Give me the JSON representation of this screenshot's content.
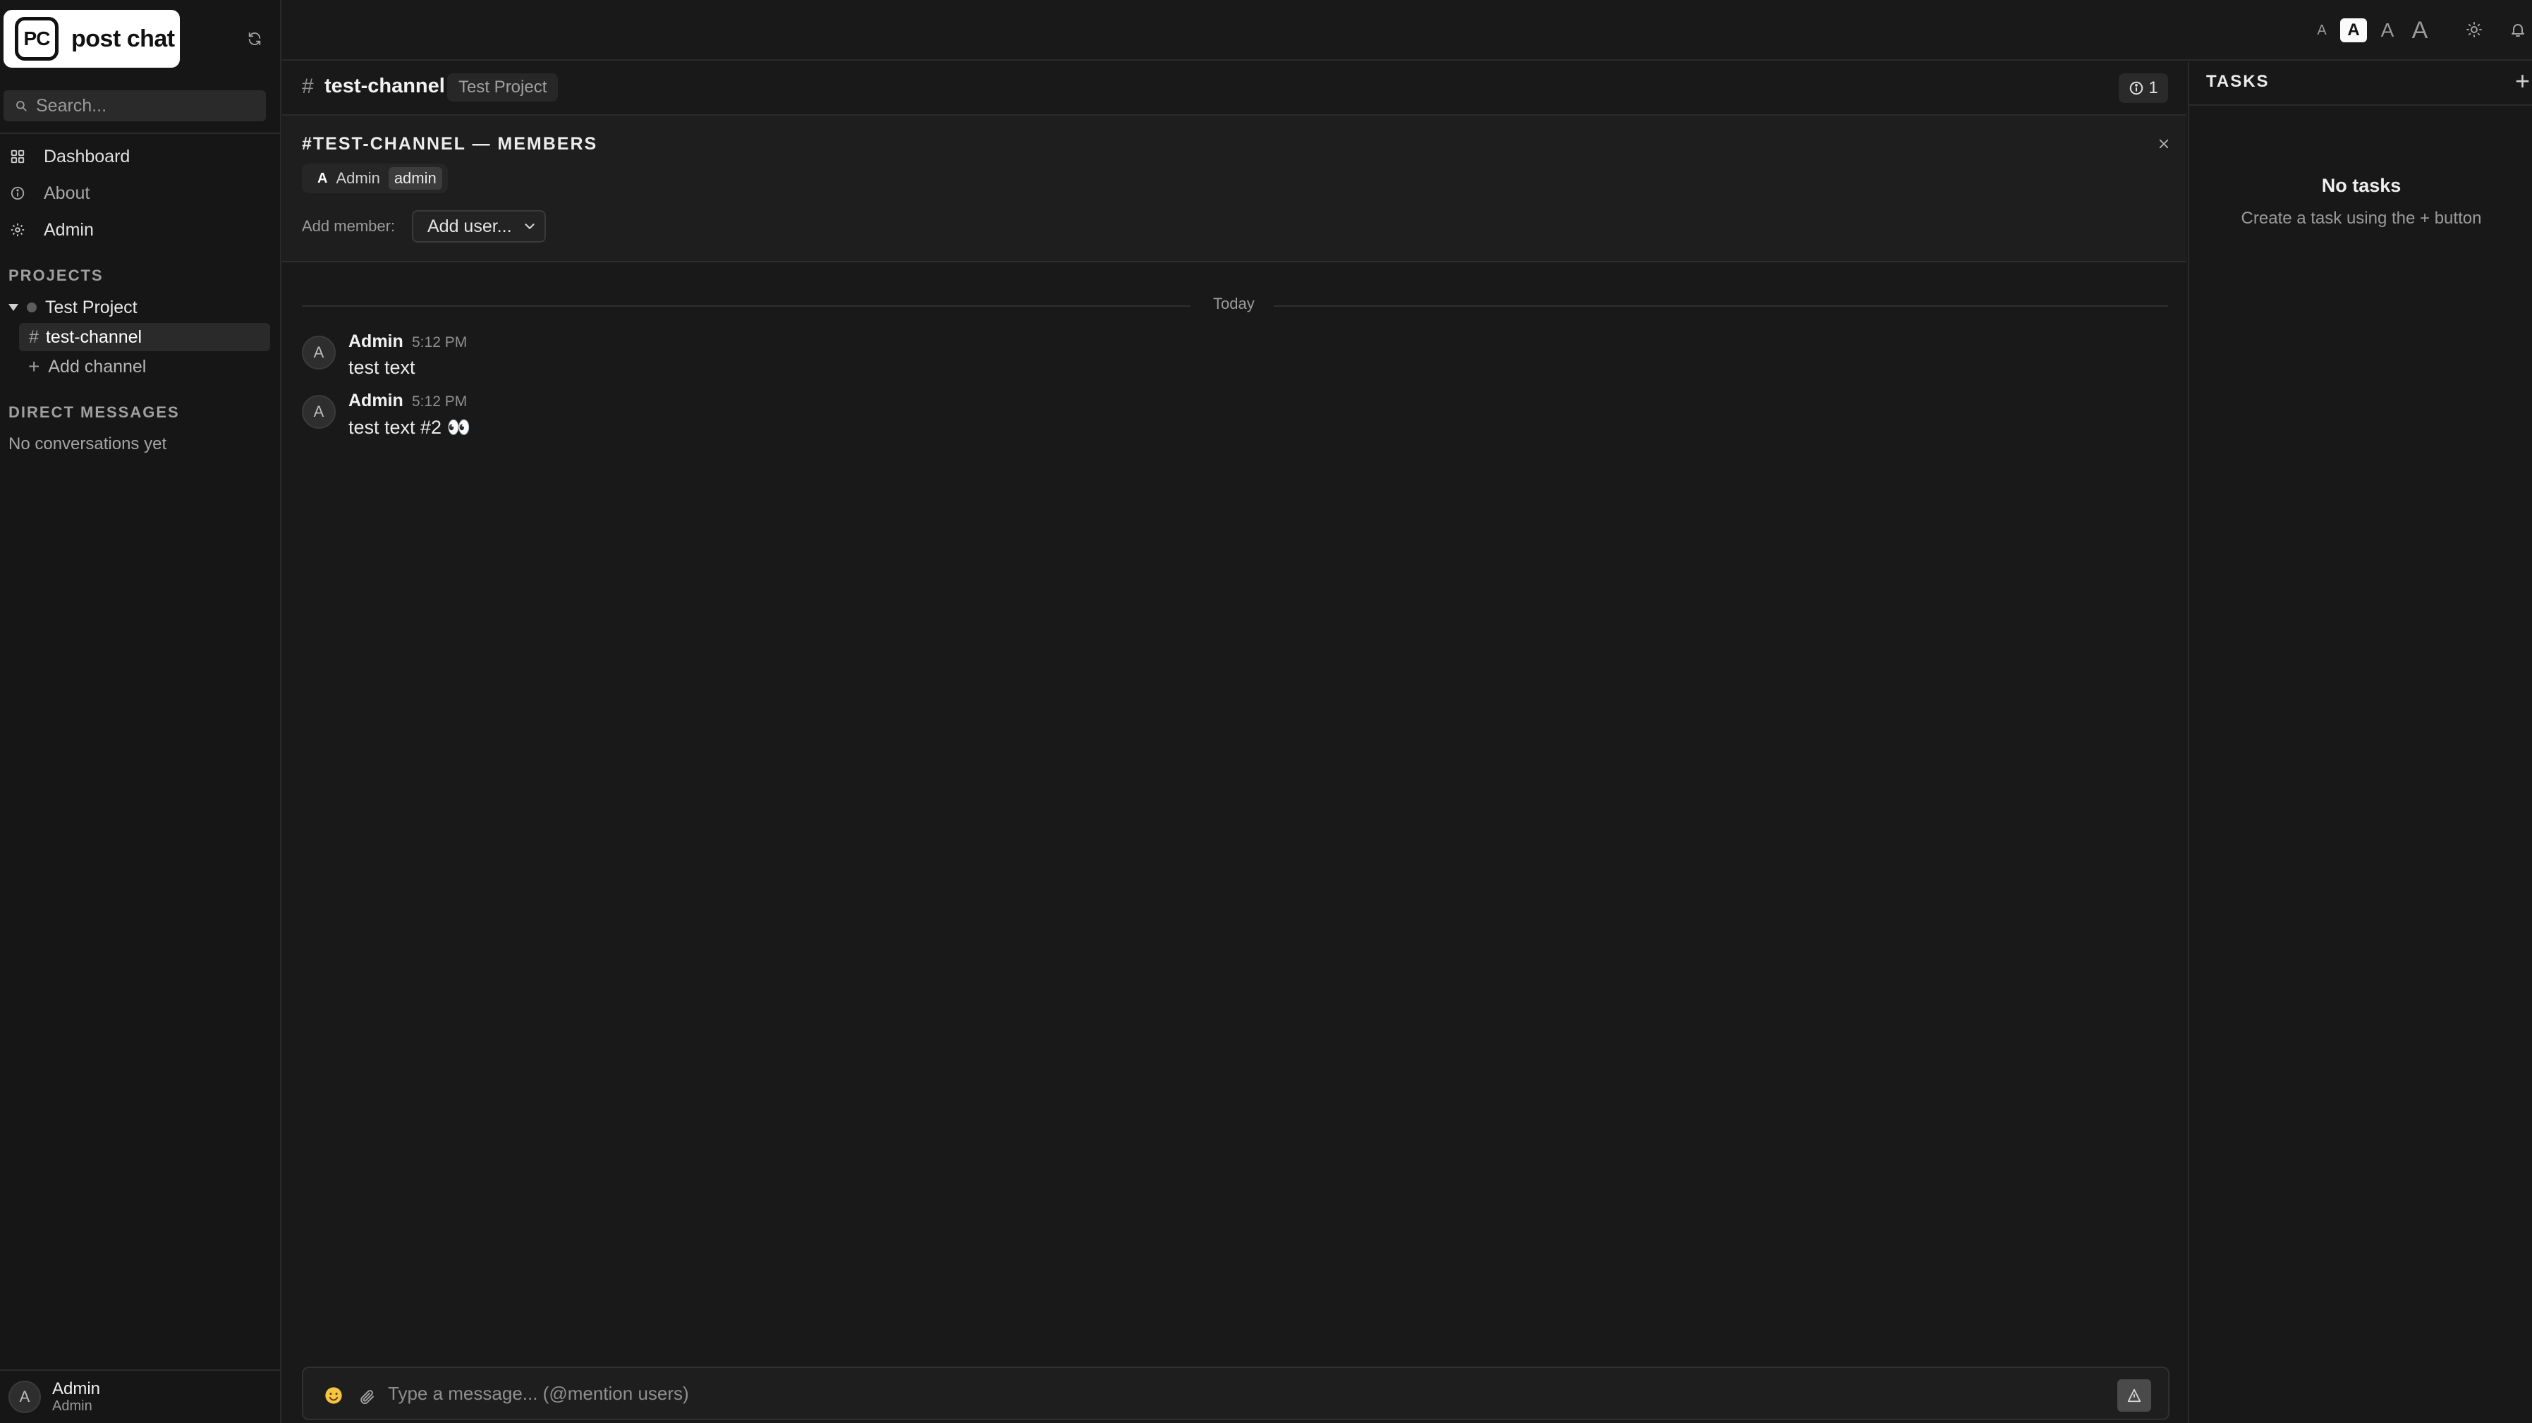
{
  "brand": {
    "initials": "PC",
    "name": "post chat"
  },
  "search": {
    "placeholder": "Search..."
  },
  "nav": [
    {
      "label": "Dashboard",
      "icon": "grid-icon"
    },
    {
      "label": "About",
      "icon": "info-icon"
    },
    {
      "label": "Admin",
      "icon": "gear-icon"
    }
  ],
  "projects": {
    "heading": "PROJECTS",
    "project_name": "Test Project",
    "channel": "test-channel",
    "add_channel": "Add channel"
  },
  "direct_messages": {
    "heading": "DIRECT MESSAGES",
    "empty": "No conversations yet"
  },
  "current_user": {
    "initial": "A",
    "name": "Admin",
    "role": "Admin"
  },
  "font_size_options": [
    "A",
    "A",
    "A",
    "A"
  ],
  "channel_header": {
    "hash": "#",
    "name": "test-channel",
    "project": "Test Project",
    "info_count": "1"
  },
  "members_panel": {
    "title": "#TEST-CHANNEL — MEMBERS",
    "member": {
      "initial": "A",
      "name": "Admin",
      "role_tag": "admin"
    },
    "add_member_label": "Add member:",
    "add_member_select": "Add user..."
  },
  "day_separator": "Today",
  "messages": [
    {
      "initial": "A",
      "author": "Admin",
      "time": "5:12 PM",
      "text": "test text"
    },
    {
      "initial": "A",
      "author": "Admin",
      "time": "5:12 PM",
      "text": "test text #2 👀"
    }
  ],
  "composer": {
    "placeholder": "Type a message... (@mention users)"
  },
  "tasks": {
    "title": "TASKS",
    "add": "+",
    "empty_title": "No tasks",
    "empty_sub": "Create a task using the + button"
  },
  "colors": {
    "background": "#191919",
    "sidebar": "#161616",
    "accent": "#ffffff",
    "border": "#2a2a2a"
  }
}
